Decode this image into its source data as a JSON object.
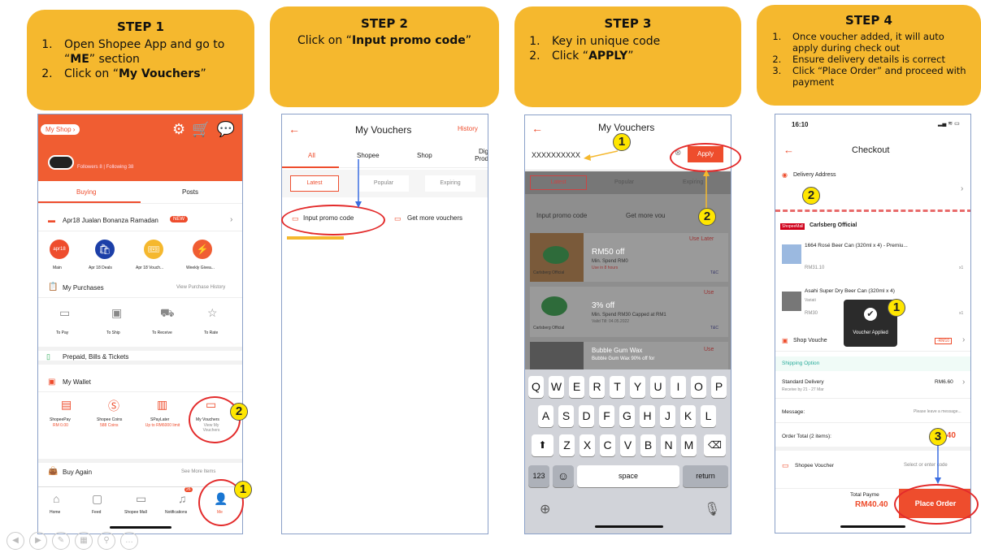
{
  "steps": [
    {
      "title": "STEP 1",
      "items": [
        "Open Shopee App and go to “ME” section",
        "Click on “My Vouchers”"
      ]
    },
    {
      "title": "STEP 2",
      "text": "Click on “Input promo code”"
    },
    {
      "title": "STEP 3",
      "items": [
        "Key in unique code",
        "Click “APPLY”"
      ]
    },
    {
      "title": "STEP 4",
      "items": [
        "Once voucher added, it will auto apply during check out",
        "Ensure delivery details is correct",
        "Click “Place Order” and proceed with payment"
      ]
    }
  ],
  "step1": {
    "my_shop": "My Shop",
    "followers": "Followers 8",
    "following": "Following 38",
    "tab_buying": "Buying",
    "tab_posts": "Posts",
    "promo": "Apr18 Jualan Bonanza Ramadan",
    "promo_badge": "NEW",
    "shortcuts": [
      "Main",
      "Apr 18 Deals",
      "Apr 18 Vouch...",
      "Weekly Givea..."
    ],
    "purchases": "My Purchases",
    "purchase_history": "View Purchase History",
    "purchase_states": [
      "To Pay",
      "To Ship",
      "To Receive",
      "To Rate"
    ],
    "prepaid": "Prepaid, Bills & Tickets",
    "wallet": "My Wallet",
    "wallet_items": [
      {
        "name": "ShopeePay",
        "sub": "RM 0.00"
      },
      {
        "name": "Shopee Coins",
        "sub": "588 Coins"
      },
      {
        "name": "SPayLater",
        "sub": "Up to RM6000 limit"
      },
      {
        "name": "My Vouchers",
        "sub": "View My Vouchers"
      }
    ],
    "buy_again": "Buy Again",
    "see_more": "See More Items",
    "nav": [
      "Home",
      "Feed",
      "Shopee Mall",
      "Notifications",
      "Me"
    ],
    "notif_badge": "26"
  },
  "step2": {
    "title": "My Vouchers",
    "history": "History",
    "tabs": [
      "All",
      "Shopee",
      "Shop",
      "Dig Prod"
    ],
    "filters": [
      "Latest",
      "Popular",
      "Expiring"
    ],
    "input_promo": "Input promo code",
    "get_more": "Get more vouchers"
  },
  "step3": {
    "title": "My Vouchers",
    "code": "XXXXXXXXXX",
    "apply": "Apply",
    "filters": [
      "Latest",
      "Popular",
      "Expiring"
    ],
    "input_promo": "Input promo code",
    "get_more": "Get more vou",
    "vouchers": [
      {
        "title": "RM50 off",
        "sub": "Min. Spend RM0",
        "extra": "Use in 8 hours",
        "action": "Use Later",
        "shop": "Carlsberg Official"
      },
      {
        "title": "3% off",
        "sub": "Min. Spend RM30 Capped at RM1",
        "extra": "Valid Till: 04.05.2022",
        "action": "Use",
        "shop": "Carlsberg Official"
      },
      {
        "title": "Bubble Gum Wax",
        "sub": "Bubble Gum Wax 90% off for",
        "extra": "",
        "action": "Use",
        "shop": ""
      }
    ],
    "keys_r1": [
      "Q",
      "W",
      "E",
      "R",
      "T",
      "Y",
      "U",
      "I",
      "O",
      "P"
    ],
    "keys_r2": [
      "A",
      "S",
      "D",
      "F",
      "G",
      "H",
      "J",
      "K",
      "L"
    ],
    "keys_r3": [
      "Z",
      "X",
      "C",
      "V",
      "B",
      "N",
      "M"
    ],
    "k123": "123",
    "space": "space",
    "return": "return",
    "tc": "T&C"
  },
  "step4": {
    "time": "16:10",
    "title": "Checkout",
    "delivery": "Delivery Address",
    "mall": "ShopeeMall",
    "shop": "Carlsberg Official",
    "items": [
      {
        "name": "1664 Rosé Beer Can (320ml x 4) - Premiu...",
        "price": "RM31.10",
        "qty": "x1"
      },
      {
        "name": "Asahi Super Dry Beer Can (320ml x 4)",
        "variation": "Variati",
        "price": "RM30",
        "qty": "x1"
      }
    ],
    "toast": "Voucher Applied",
    "shop_voucher": "Shop Vouche",
    "shop_voucher_tag": "-RM10",
    "shipping_option": "Shipping Option",
    "standard": "Standard Delivery",
    "standard_price": "RM6.60",
    "receive": "Receive by 21 - 27 Mar",
    "message": "Message:",
    "message_ph": "Please leave a message...",
    "order_total": "Order Total (2 items):",
    "order_total_val": ".40",
    "shopee_voucher": "Shopee Voucher",
    "select_code": "Select or enter code",
    "total_payment": "Total Payme",
    "total_val": "RM40.40",
    "place_order": "Place Order"
  },
  "markers": [
    "1",
    "2",
    "3"
  ]
}
